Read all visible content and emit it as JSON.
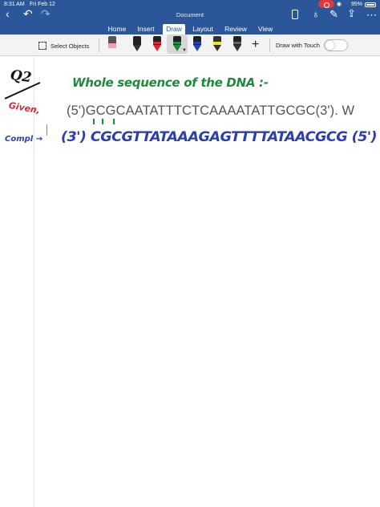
{
  "status_bar": {
    "time": "8:31 AM",
    "date": "Fri Feb 12",
    "battery": "95%"
  },
  "document": {
    "title": "Document"
  },
  "tabs": [
    {
      "label": "Home"
    },
    {
      "label": "Insert"
    },
    {
      "label": "Draw",
      "active": true
    },
    {
      "label": "Layout"
    },
    {
      "label": "Review"
    },
    {
      "label": "View"
    }
  ],
  "toolbar": {
    "select_objects_label": "Select Objects",
    "draw_with_touch_label": "Draw with Touch",
    "draw_with_touch_on": false,
    "pens": [
      {
        "icon": "eraser-icon",
        "color": "#f0a0b0"
      },
      {
        "icon": "pen-icon",
        "color": "#333333"
      },
      {
        "icon": "pen-icon",
        "color": "#d8283c"
      },
      {
        "icon": "pen-icon",
        "color": "#1e8a3c",
        "selected": true
      },
      {
        "icon": "pen-icon",
        "color": "#2b3fb0"
      },
      {
        "icon": "highlighter-icon",
        "color": "#f2e62a"
      },
      {
        "icon": "pen-icon",
        "color": "#333333"
      }
    ]
  },
  "content": {
    "typed_sequence": "(5')GCGCAATATTTCTCAAAATATTGCGC(3'). W",
    "handwriting": {
      "question_label": "Q2",
      "given_label": "Given,",
      "heading": "Whole sequence of the DNA :-",
      "complement_label": "Compl →",
      "complement_strand": "(3') CGCGTTATAAAGAGTTTTATAACGCG (5')"
    }
  },
  "colors": {
    "ribbon": "#2b579a",
    "ink_black": "#111111",
    "ink_red": "#d8283c",
    "ink_green": "#1e8a3c",
    "ink_blue": "#2b3fb0"
  }
}
